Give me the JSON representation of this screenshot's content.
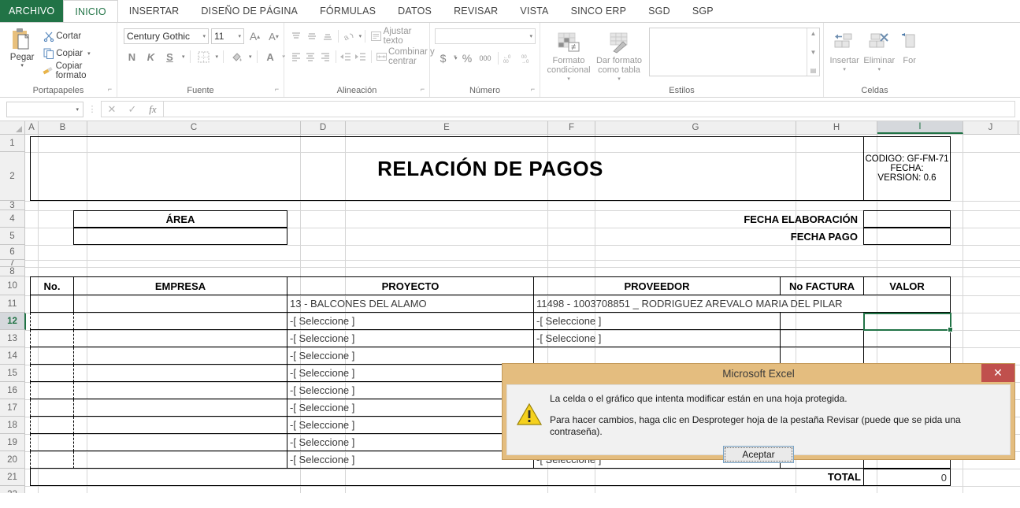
{
  "ribbon": {
    "tabs": [
      {
        "label": "ARCHIVO",
        "kind": "file"
      },
      {
        "label": "INICIO",
        "kind": "active"
      },
      {
        "label": "INSERTAR",
        "kind": "normal"
      },
      {
        "label": "DISEÑO DE PÁGINA",
        "kind": "normal"
      },
      {
        "label": "FÓRMULAS",
        "kind": "normal"
      },
      {
        "label": "DATOS",
        "kind": "normal"
      },
      {
        "label": "REVISAR",
        "kind": "normal"
      },
      {
        "label": "VISTA",
        "kind": "normal"
      },
      {
        "label": "SINCO ERP",
        "kind": "normal"
      },
      {
        "label": "SGD",
        "kind": "normal"
      },
      {
        "label": "SGP",
        "kind": "normal"
      }
    ],
    "groups": {
      "clipboard": {
        "label": "Portapapeles",
        "paste": "Pegar",
        "paste_icon": "clipboard-icon",
        "items": [
          {
            "label": "Cortar",
            "icon": "scissors-icon",
            "caret": false
          },
          {
            "label": "Copiar",
            "icon": "copy-icon",
            "caret": true
          },
          {
            "label": "Copiar formato",
            "icon": "format-painter-icon",
            "caret": false
          }
        ]
      },
      "font": {
        "label": "Fuente",
        "font_name": "Century Gothic",
        "font_size": "11",
        "grow_label": "A",
        "shrink_label": "A",
        "bold_label": "N",
        "italic_label": "K",
        "underline_label": "S"
      },
      "alignment": {
        "label": "Alineación",
        "wrap_text": "Ajustar texto",
        "merge_center": "Combinar y centrar"
      },
      "number": {
        "label": "Número",
        "format_value": "",
        "currency": "$",
        "percent": "%",
        "thousands": "000"
      },
      "styles": {
        "label": "Estilos",
        "conditional": "Formato condicional",
        "as_table": "Dar formato como tabla"
      },
      "cells": {
        "label": "Celdas",
        "insert": "Insertar",
        "delete": "Eliminar",
        "format": "For"
      }
    }
  },
  "formula_bar": {
    "name_box": "",
    "cancel_icon": "cancel-icon",
    "accept_icon": "check-icon",
    "fx_icon": "fx-icon",
    "formula_value": ""
  },
  "sheet": {
    "columns": [
      "A",
      "B",
      "C",
      "D",
      "E",
      "F",
      "G",
      "H",
      "I",
      "J"
    ],
    "selected_column": "I",
    "selected_row": "12",
    "active_cell": "I12",
    "rows": [
      "1",
      "2",
      "3",
      "4",
      "5",
      "6",
      "7",
      "8",
      "10",
      "11",
      "12",
      "13",
      "14",
      "15",
      "16",
      "17",
      "18",
      "19",
      "20",
      "21",
      "22"
    ],
    "title": "RELACIÓN DE PAGOS",
    "meta": {
      "codigo": "CODIGO: GF-FM-71",
      "fecha": "FECHA:",
      "version": "VERSION:  0.6"
    },
    "area_label": "ÁREA",
    "area_value": "",
    "fecha_elaboracion_label": "FECHA ELABORACIÓN",
    "fecha_elaboracion_value": "",
    "fecha_pago_label": "FECHA PAGO",
    "fecha_pago_value": "",
    "table_headers": [
      "No.",
      "EMPRESA",
      "PROYECTO",
      "PROVEEDOR",
      "No FACTURA",
      "VALOR"
    ],
    "table_rows": [
      {
        "no": "",
        "empresa": "",
        "proyecto": "13 - BALCONES DEL ALAMO",
        "proveedor": "11498 - 1003708851 _ RODRIGUEZ AREVALO MARIA DEL PILAR",
        "factura": "",
        "valor": ""
      },
      {
        "no": "",
        "empresa": "",
        "proyecto": "-[ Seleccione ]",
        "proveedor": "-[ Seleccione ]",
        "factura": "",
        "valor": ""
      },
      {
        "no": "",
        "empresa": "",
        "proyecto": "-[ Seleccione ]",
        "proveedor": "-[ Seleccione ]",
        "factura": "",
        "valor": ""
      },
      {
        "no": "",
        "empresa": "",
        "proyecto": "-[ Seleccione ]",
        "proveedor": "",
        "factura": "",
        "valor": ""
      },
      {
        "no": "",
        "empresa": "",
        "proyecto": "-[ Seleccione ]",
        "proveedor": "",
        "factura": "",
        "valor": ""
      },
      {
        "no": "",
        "empresa": "",
        "proyecto": "-[ Seleccione ]",
        "proveedor": "",
        "factura": "",
        "valor": ""
      },
      {
        "no": "",
        "empresa": "",
        "proyecto": "-[ Seleccione ]",
        "proveedor": "",
        "factura": "",
        "valor": ""
      },
      {
        "no": "",
        "empresa": "",
        "proyecto": "-[ Seleccione ]",
        "proveedor": "",
        "factura": "",
        "valor": ""
      },
      {
        "no": "",
        "empresa": "",
        "proyecto": "-[ Seleccione ]",
        "proveedor": "",
        "factura": "",
        "valor": ""
      },
      {
        "no": "",
        "empresa": "",
        "proyecto": "-[ Seleccione ]",
        "proveedor": "-[ Seleccione ]",
        "factura": "",
        "valor": ""
      }
    ],
    "total_label": "TOTAL",
    "total_value": "0"
  },
  "dialog": {
    "title": "Microsoft Excel",
    "close_icon": "close-icon",
    "warning_icon": "warning-triangle-icon",
    "line1": "La celda o el gráfico que intenta modificar están en una hoja protegida.",
    "line2": "Para hacer cambios, haga clic en Desproteger hoja de la pestaña Revisar (puede que se pida una contraseña).",
    "ok_label": "Aceptar"
  },
  "colors": {
    "excel_green": "#217346",
    "dialog_bg": "#e4bd7f",
    "close_red": "#c0504d"
  }
}
